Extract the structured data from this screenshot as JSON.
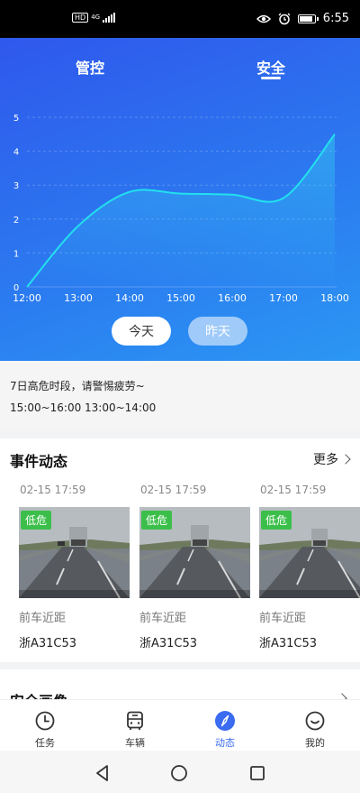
{
  "status_bar": {
    "hd": "HD",
    "network": "4G",
    "time": "6:55",
    "battery_level": 0.8
  },
  "tabs": [
    {
      "label": "管控",
      "active": false
    },
    {
      "label": "安全",
      "active": true
    }
  ],
  "chart_data": {
    "type": "area",
    "x": [
      "12:00",
      "13:00",
      "14:00",
      "15:00",
      "16:00",
      "17:00",
      "18:00"
    ],
    "series": [
      {
        "values": [
          0,
          1.8,
          2.8,
          2.75,
          2.72,
          2.62,
          4.5
        ]
      }
    ],
    "y_ticks": [
      "0",
      "1",
      "2",
      "3",
      "4",
      "5"
    ],
    "ylim": [
      0,
      5
    ],
    "grid": true,
    "line_color": "#22e0ee"
  },
  "day_buttons": {
    "today": "今天",
    "yesterday": "昨天"
  },
  "notice": {
    "line1": "7日高危时段，请警惕疲劳~",
    "line2": "15:00~16:00 13:00~14:00"
  },
  "events": {
    "title": "事件动态",
    "more": "更多",
    "items": [
      {
        "time": "02-15 17:59",
        "badge": "低危",
        "type": "前车近距",
        "plate": "浙A31C53"
      },
      {
        "time": "02-15 17:59",
        "badge": "低危",
        "type": "前车近距",
        "plate": "浙A31C53"
      },
      {
        "time": "02-15 17:59",
        "badge": "低危",
        "type": "前车近距",
        "plate": "浙A31C53"
      }
    ]
  },
  "safety_portrait": {
    "title": "安全画像"
  },
  "bottom_nav": [
    {
      "label": "任务",
      "icon": "clock-icon",
      "active": false
    },
    {
      "label": "车辆",
      "icon": "bus-icon",
      "active": false
    },
    {
      "label": "动态",
      "icon": "compass-icon",
      "active": true
    },
    {
      "label": "我的",
      "icon": "smile-icon",
      "active": false
    }
  ],
  "colors": {
    "accent": "#3a6bf0",
    "badge_green": "#3cbf4a",
    "hero_start": "#2f58ec",
    "hero_end": "#2b97f3"
  }
}
